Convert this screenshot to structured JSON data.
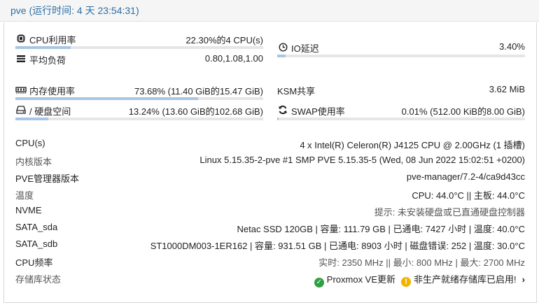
{
  "header": {
    "title": "pve (运行时间: 4 天 23:54:31)"
  },
  "stats": {
    "cpu": {
      "label": "CPU利用率",
      "value": "22.30%的4 CPU(s)",
      "percent": 22.3
    },
    "load": {
      "label": "平均负荷",
      "value": "0.80,1.08,1.00"
    },
    "io": {
      "label": "IO延迟",
      "value": "3.40%"
    },
    "memory": {
      "label": "内存使用率",
      "value": "73.68% (11.40 GiB的15.47 GiB)",
      "percent": 73.68
    },
    "ksm": {
      "label": "KSM共享",
      "value": "3.62 MiB"
    },
    "disk": {
      "label": "/ 硬盘空间",
      "value": "13.24% (13.60 GiB的102.68 GiB)",
      "percent": 13.24
    },
    "swap": {
      "label": "SWAP使用率",
      "value": "0.01% (512.00 KiB的8.00 GiB)",
      "percent": 0.01
    }
  },
  "info": [
    {
      "key": "CPU(s)",
      "value": "4 x Intel(R) Celeron(R) J4125 CPU @ 2.00GHz (1 插槽)"
    },
    {
      "key": "内核版本",
      "value": "Linux 5.15.35-2-pve #1 SMP PVE 5.15.35-5 (Wed, 08 Jun 2022 15:02:51 +0200)"
    },
    {
      "key": "PVE管理器版本",
      "value": "pve-manager/7.2-4/ca9d43cc"
    },
    {
      "key": "温度",
      "value": "CPU: 44.0°C || 主板: 44.0°C"
    },
    {
      "key": "NVME",
      "value": "提示: 未安装硬盘或已直通硬盘控制器"
    },
    {
      "key": "SATA_sda",
      "value": "Netac SSD 120GB | 容量: 111.79 GB | 已通电: 7427 小时 | 温度: 40.0°C"
    },
    {
      "key": "SATA_sdb",
      "value": "ST1000DM003-1ER162 | 容量: 931.51 GB | 已通电: 8903 小时 | 磁盘错误: 252 | 温度: 30.0°C"
    },
    {
      "key": "CPU频率",
      "value": "实时: 2350 MHz || 最小: 800 MHz | 最大: 2700 MHz"
    }
  ],
  "repo": {
    "key": "存储库状态",
    "ok_text": "Proxmox VE更新",
    "warn_text": "非生产就绪存储库已启用!"
  },
  "icons": {
    "cpu": "cpu-chip-icon",
    "load": "tasks-icon",
    "io": "clock-icon",
    "memory": "memory-icon",
    "disk": "hdd-icon",
    "swap": "refresh-icon",
    "ok": "check-circle-icon",
    "warn": "exclamation-circle-icon",
    "chevron": "chevron-right-icon"
  },
  "colors": {
    "title": "#2d6ea6",
    "bar_fill": "#a8c6e3",
    "ok": "#2ea043",
    "warn": "#f0b400"
  }
}
